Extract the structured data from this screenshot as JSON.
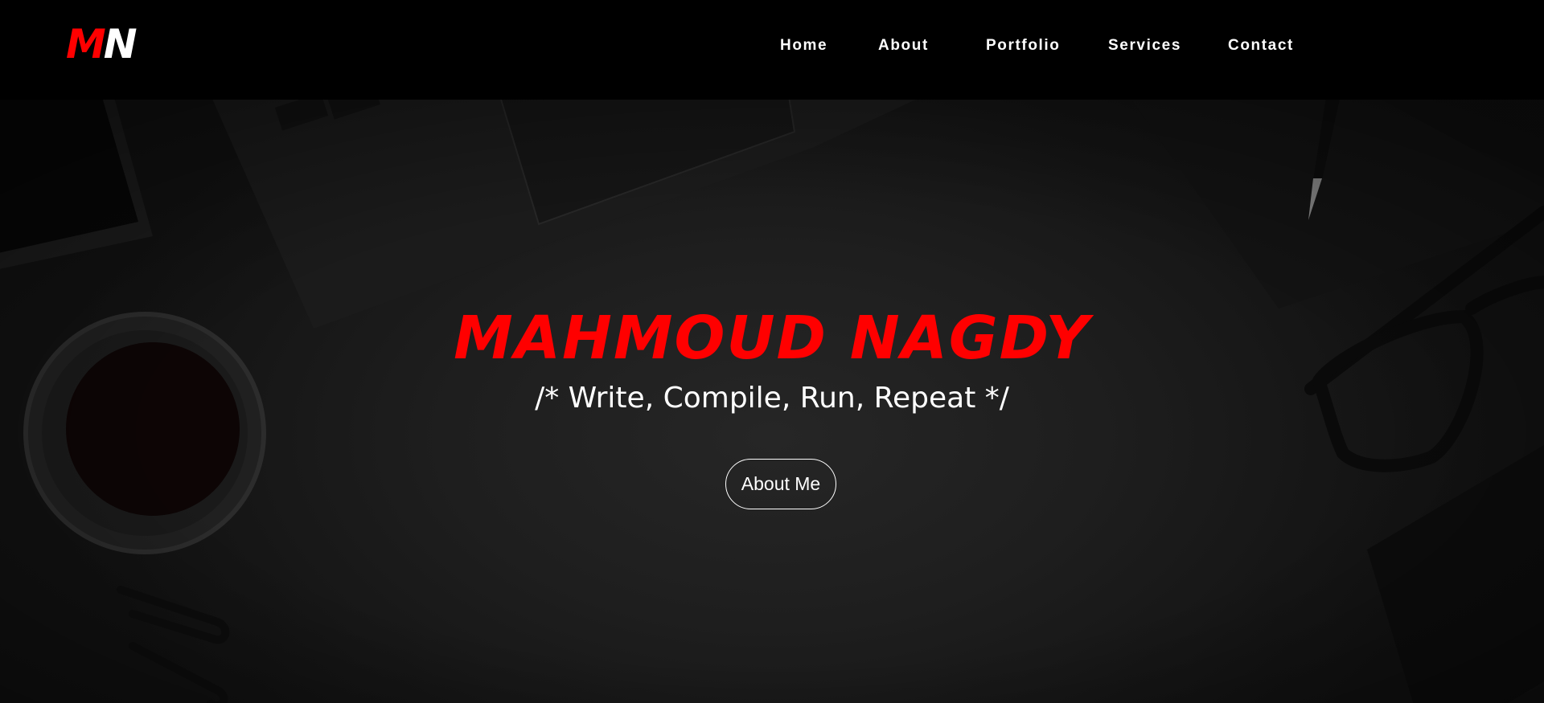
{
  "brand": {
    "logo_first": "M",
    "logo_second": "N",
    "accent_color": "#ff0000"
  },
  "nav": {
    "items": [
      {
        "label": "Home"
      },
      {
        "label": "About"
      },
      {
        "label": "Portfolio"
      },
      {
        "label": "Services"
      },
      {
        "label": "Contact"
      }
    ]
  },
  "hero": {
    "title": "MAHMOUD NAGDY",
    "subtitle": "/* Write, Compile, Run, Repeat */",
    "button_label": "About Me",
    "background": "dark desk with laptop, coffee cup, glasses, notebook, pencil, paper clips"
  }
}
